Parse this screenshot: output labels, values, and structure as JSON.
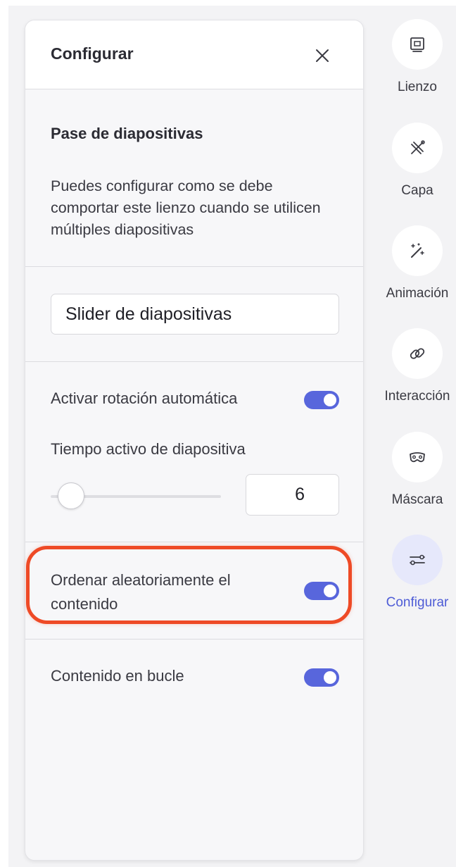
{
  "panel": {
    "title": "Configurar",
    "close_icon": "close-icon",
    "section_title": "Pase de diapositivas",
    "section_desc": "Puedes configurar como se debe comportar este lienzo cuando se utilicen múltiples diapositivas",
    "slider_name_value": "Slider de diapositivas",
    "auto_rotation": {
      "label": "Activar rotación automática",
      "enabled": true
    },
    "active_time": {
      "label": "Tiempo activo de diapositiva",
      "value": "6",
      "slider_position": 0.12
    },
    "shuffle": {
      "label": "Ordenar aleatoriamente el contenido",
      "enabled": true
    },
    "loop": {
      "label": "Contenido en bucle",
      "enabled": true
    }
  },
  "toolbar": {
    "items": [
      {
        "label": "Lienzo",
        "icon": "canvas-icon",
        "active": false
      },
      {
        "label": "Capa",
        "icon": "layer-icon",
        "active": false
      },
      {
        "label": "Animación",
        "icon": "magic-wand-icon",
        "active": false
      },
      {
        "label": "Interacción",
        "icon": "link-icon",
        "active": false
      },
      {
        "label": "Máscara",
        "icon": "mask-icon",
        "active": false
      },
      {
        "label": "Configurar",
        "icon": "settings-sliders-icon",
        "active": true
      }
    ]
  },
  "colors": {
    "accent": "#5866dc",
    "active_label": "#4e5cd6",
    "highlight": "#ee4a26"
  }
}
